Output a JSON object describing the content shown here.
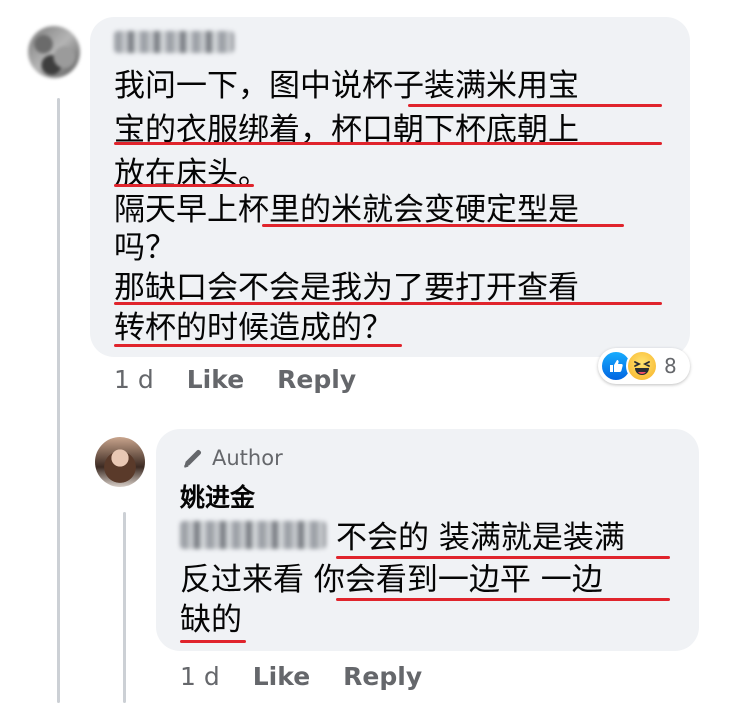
{
  "comment1": {
    "lines": [
      "我问一下，图中说杯子装满米用宝",
      "宝的衣服绑着，杯口朝下杯底朝上",
      "放在床头。",
      "隔天早上杯里的米就会变硬定型是",
      "吗？",
      "那缺口会不会是我为了要打开查看",
      "转杯的时候造成的？"
    ],
    "time": "1 d",
    "like_label": "Like",
    "reply_label": "Reply",
    "reaction_count": "8"
  },
  "comment2": {
    "badge": "Author",
    "author": "姚进金",
    "lines": [
      "不会的 装满就是装满",
      "反过来看 你会看到一边平 一边",
      "缺的"
    ],
    "time": "1 d",
    "like_label": "Like",
    "reply_label": "Reply"
  },
  "colors": {
    "bubble": "#f0f2f5",
    "underline": "#e0242c",
    "meta": "#65676b"
  }
}
